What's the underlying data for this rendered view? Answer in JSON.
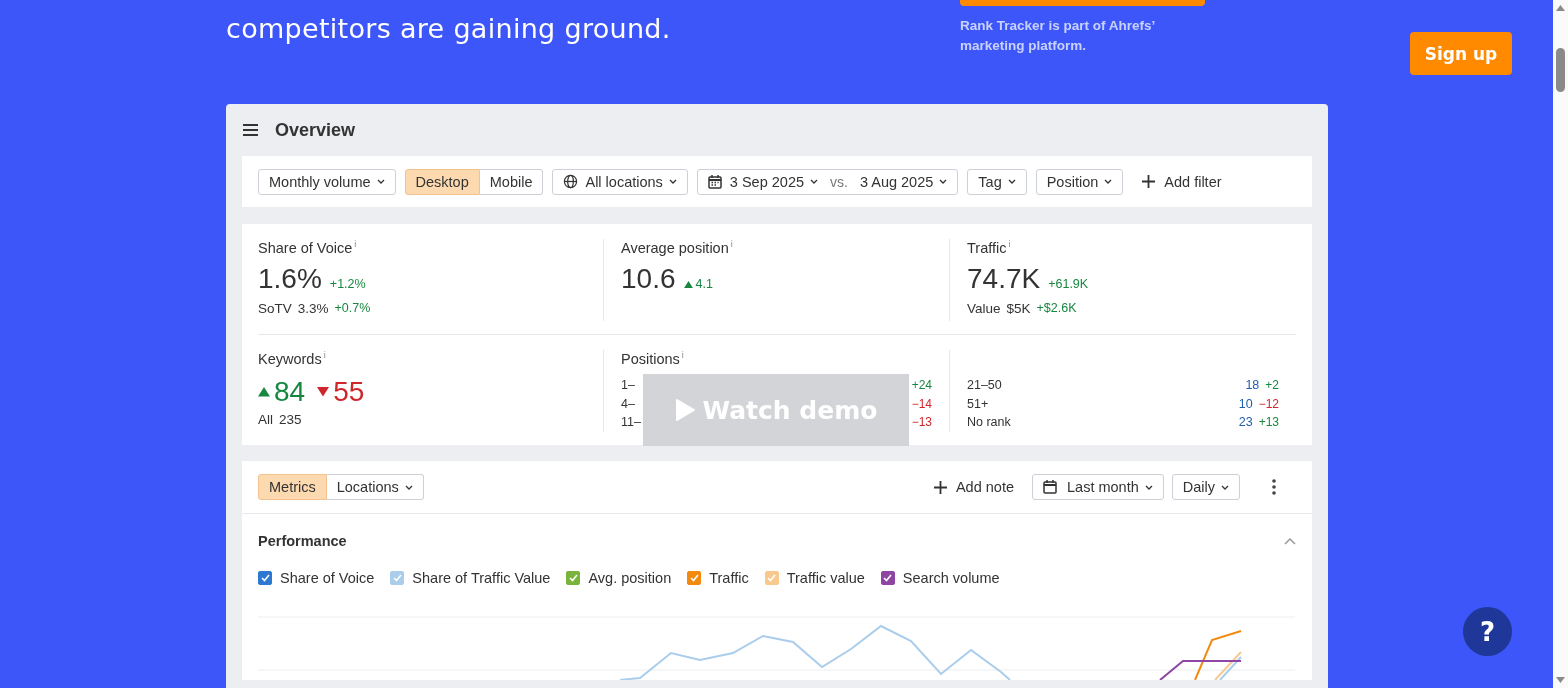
{
  "hero": {
    "headline": "competitors are gaining ground.",
    "note": "Rank Tracker is part of Ahrefs’ marketing platform.",
    "signup": "Sign up"
  },
  "overview": {
    "title": "Overview",
    "filters": [
      {
        "kind": "dropdown",
        "label": "Monthly volume"
      },
      {
        "kind": "segment",
        "options": [
          {
            "label": "Desktop",
            "selected": true
          },
          {
            "label": "Mobile",
            "selected": false
          }
        ]
      },
      {
        "kind": "location",
        "label": "All locations"
      },
      {
        "kind": "date_range",
        "from": "3 Sep 2025",
        "separator": "vs.",
        "to": "3 Aug 2025"
      },
      {
        "kind": "dropdown",
        "label": "Tag"
      },
      {
        "kind": "dropdown",
        "label": "Position"
      },
      {
        "kind": "add",
        "label": "Add filter"
      }
    ]
  },
  "stats": {
    "share_of_voice": {
      "label": "Share of Voice",
      "info": "i",
      "value": "1.6%",
      "delta": "+1.2%",
      "sub_label": "SoTV",
      "sub_value": "3.3%",
      "sub_delta": "+0.7%"
    },
    "average_position": {
      "label": "Average position",
      "info": "i",
      "value": "10.6",
      "delta": "4.1",
      "rising": true
    },
    "traffic": {
      "label": "Traffic",
      "info": "i",
      "value": "74.7K",
      "delta": "+61.9K",
      "sub_label": "Value",
      "sub_value": "$5K",
      "sub_delta": "+$2.6K"
    },
    "keywords": {
      "label": "Keywords",
      "info": "i",
      "gained": "84",
      "lost": "55",
      "total_label": "All",
      "total": "235"
    },
    "positions": {
      "label": "Positions",
      "info": "i",
      "left": [
        {
          "range": "1–",
          "delta": "+24",
          "rising": true
        },
        {
          "range": "4–",
          "delta": "−14",
          "rising": false
        },
        {
          "range": "11–",
          "delta": "−13",
          "rising": false
        }
      ],
      "right": [
        {
          "range": "21–50",
          "count": "18",
          "delta": "+2",
          "rising": true
        },
        {
          "range": "51+",
          "count": "10",
          "delta": "−12",
          "rising": false
        },
        {
          "range": "No rank",
          "count": "23",
          "delta": "+13",
          "rising": true
        }
      ]
    },
    "demo_overlay": {
      "label": "Watch demo"
    }
  },
  "performance": {
    "tabs": [
      {
        "label": "Metrics",
        "selected": true,
        "kind": "tab"
      },
      {
        "label": "Locations",
        "selected": false,
        "kind": "dropdown"
      }
    ],
    "add_note": "Add note",
    "period": "Last month",
    "interval": "Daily",
    "section": {
      "title": "Performance",
      "expanded": true
    },
    "legend": [
      {
        "label": "Share of Voice",
        "color": "#2f78d1",
        "checked": true
      },
      {
        "label": "Share of Traffic Value",
        "color": "#a9cdeb",
        "checked": true
      },
      {
        "label": "Avg. position",
        "color": "#7ab33b",
        "checked": true
      },
      {
        "label": "Traffic",
        "color": "#f28a10",
        "checked": true
      },
      {
        "label": "Traffic value",
        "color": "#f8c88d",
        "checked": true
      },
      {
        "label": "Search volume",
        "color": "#8e45a3",
        "checked": true
      }
    ]
  },
  "help": {
    "label": "?"
  }
}
